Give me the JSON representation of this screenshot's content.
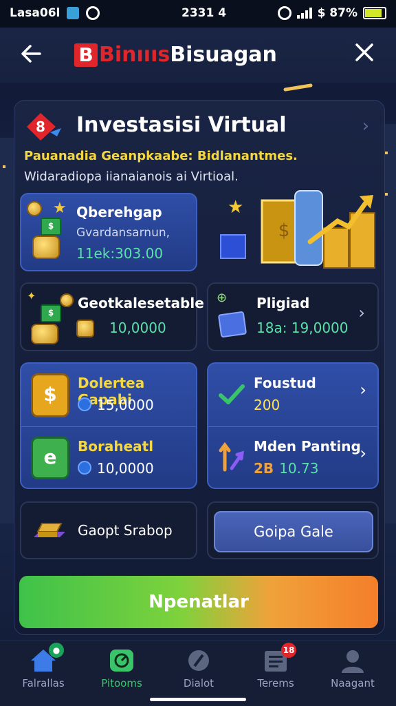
{
  "status_bar": {
    "left_text": "Lasa06l",
    "time": "2331 4",
    "battery": "$ 87%"
  },
  "header": {
    "brand_letter": "B",
    "brand_red": "Binıııs",
    "brand_white": "Bisuagan"
  },
  "card": {
    "title": "Investasisi Virtual",
    "subtitle": "Pauanadia Geanpkaabe: Bidlanantmes.",
    "description": "Widaradiopa iianaianois ai Virtioal."
  },
  "tiles": {
    "top_left": {
      "label": "Qberehgap",
      "sub": "Gvardansarnun,",
      "value": "11ek:303.00"
    },
    "mid_left": {
      "label": "Geotkalesetable",
      "value": "10,0000"
    },
    "mid_right": {
      "label": "Pligiad",
      "value": "18a: 19,0000"
    },
    "blue_left_top": {
      "label": "Dolertea Gapabi",
      "value": "15,0000"
    },
    "blue_left_bottom": {
      "label": "Boraheatl",
      "value": "10,0000"
    },
    "blue_right_top": {
      "label": "Foustud",
      "value": "200"
    },
    "blue_right_bottom": {
      "label": "Mden Panting",
      "value_prefix": "2B",
      "value": "10.73"
    },
    "bottom_left": {
      "label": "Gaopt Srabop"
    },
    "bottom_right": {
      "label": "Goipa Gale"
    }
  },
  "cta_label": "Npenatlar",
  "nav": {
    "items": [
      {
        "label": "Falrallas",
        "badge": ""
      },
      {
        "label": "Pitooms"
      },
      {
        "label": "Dialot"
      },
      {
        "label": "Terems",
        "badge": "18"
      },
      {
        "label": "Naagant"
      }
    ]
  },
  "colors": {
    "accent_green": "#3ac46a",
    "brand_red": "#e0262b",
    "tile_blue": "#2f4ea7",
    "value_green": "#5be1a9",
    "subtitle_yellow": "#f5d742"
  }
}
